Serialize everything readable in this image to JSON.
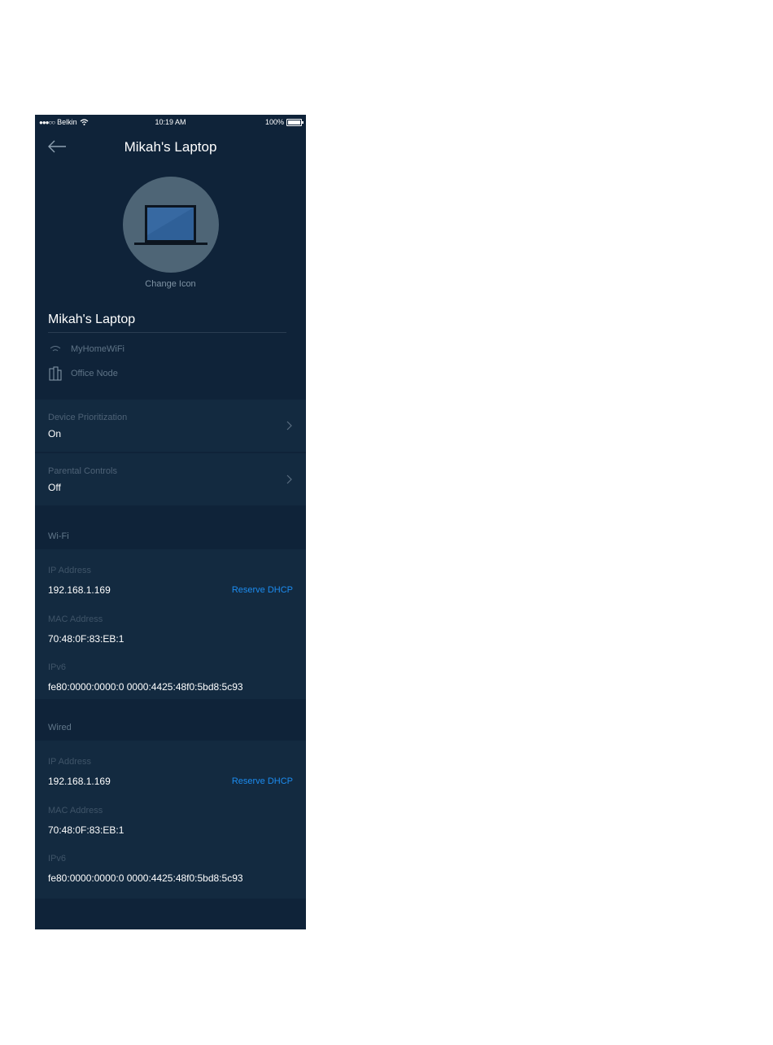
{
  "status_bar": {
    "carrier": "Belkin",
    "time": "10:19 AM",
    "battery": "100%"
  },
  "nav": {
    "title": "Mikah's Laptop"
  },
  "device": {
    "change_icon_label": "Change Icon",
    "name": "Mikah's Laptop",
    "network": "MyHomeWiFi",
    "node": "Office Node"
  },
  "settings": [
    {
      "label": "Device Prioritization",
      "value": "On"
    },
    {
      "label": "Parental Controls",
      "value": "Off"
    }
  ],
  "wifi": {
    "title": "Wi-Fi",
    "ip_label": "IP Address",
    "ip": "192.168.1.169",
    "reserve": "Reserve DHCP",
    "mac_label": "MAC Address",
    "mac": "70:48:0F:83:EB:1",
    "ipv6_label": "IPv6",
    "ipv6": "fe80:0000:0000:0 0000:4425:48f0:5bd8:5c93"
  },
  "wired": {
    "title": "Wired",
    "ip_label": "IP Address",
    "ip": "192.168.1.169",
    "reserve": "Reserve DHCP",
    "mac_label": "MAC Address",
    "mac": "70:48:0F:83:EB:1",
    "ipv6_label": "IPv6",
    "ipv6": "fe80:0000:0000:0 0000:4425:48f0:5bd8:5c93"
  },
  "colors": {
    "background": "#0f2339",
    "card": "#132a40",
    "link": "#1c8cf0",
    "avatar": "#4e6576"
  },
  "icons": [
    "back-arrow-icon",
    "laptop-icon",
    "wifi-icon",
    "node-icon",
    "chevron-right-icon",
    "battery-icon"
  ]
}
